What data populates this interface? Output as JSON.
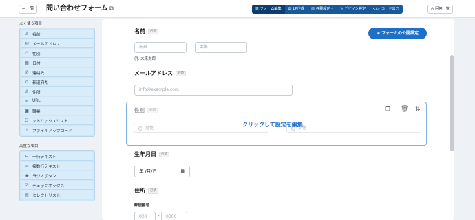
{
  "header": {
    "back_label": "← 一覧",
    "title": "問い合わせフォーム",
    "tabs": [
      {
        "icon": "☰",
        "label": "フォーム編集"
      },
      {
        "icon": "▤",
        "label": "LP作成"
      },
      {
        "icon": "▥",
        "label": "各種設定 ▾"
      },
      {
        "icon": "✎",
        "label": "デザイン設定"
      },
      {
        "icon": "</>",
        "label": "コード出力"
      }
    ],
    "history_label": "回答一覧"
  },
  "sidebar": {
    "basic_title": "よく使う項目",
    "basic_items": [
      {
        "icon": "♙",
        "label": "名前"
      },
      {
        "icon": "✉",
        "label": "メールアドレス"
      },
      {
        "icon": "⚇",
        "label": "性別"
      },
      {
        "icon": "▦",
        "label": "日付"
      },
      {
        "icon": "✆",
        "label": "連絡先"
      },
      {
        "icon": "⊙",
        "label": "都道府県"
      },
      {
        "icon": "♙",
        "label": "住所"
      },
      {
        "icon": "∞",
        "label": "URL"
      },
      {
        "icon": "◙",
        "label": "職業"
      },
      {
        "icon": "☷",
        "label": "マトリックスリスト"
      },
      {
        "icon": "⇪",
        "label": "ファイルアップロード"
      }
    ],
    "advanced_title": "高度な項目",
    "advanced_items": [
      {
        "icon": "⊖",
        "label": "一行テキスト"
      },
      {
        "icon": "▭",
        "label": "複数行テキスト"
      },
      {
        "icon": "◉",
        "label": "ラジオボタン"
      },
      {
        "icon": "☑",
        "label": "チェックボックス"
      },
      {
        "icon": "▤",
        "label": "セレクトリスト"
      }
    ]
  },
  "form": {
    "publish_button": "フォームの公開設定",
    "name": {
      "label": "名前",
      "required": "必須",
      "last_placeholder": "未来",
      "first_placeholder": "太郎",
      "example": "例: 未来太郎"
    },
    "email": {
      "label": "メールアドレス",
      "required": "必須",
      "placeholder": "info@example.com"
    },
    "gender": {
      "label": "性別",
      "required": "必須",
      "options": [
        "男性",
        "女性"
      ],
      "overlay": "クリックして設定を編集"
    },
    "birthday": {
      "label": "生年月日",
      "required": "必須",
      "value": "年 /月/日"
    },
    "address": {
      "label": "住所",
      "required": "必須",
      "zip_label": "郵便番号",
      "zip1": "000",
      "zip2": "0000"
    }
  }
}
